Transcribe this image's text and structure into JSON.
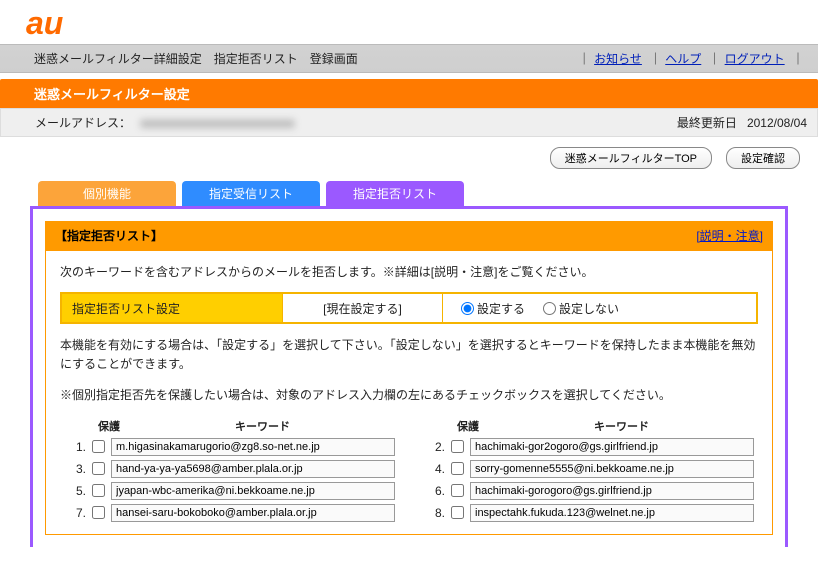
{
  "logo_alt": "au",
  "breadcrumb": "迷惑メールフィルター詳細設定　指定拒否リスト　登録画面",
  "toplinks": {
    "news": "お知らせ",
    "help": "ヘルプ",
    "logout": "ログアウト"
  },
  "orange_title": "迷惑メールフィルター設定",
  "info": {
    "mail_label": "メールアドレス：",
    "mail_value": "xxxxxxxxxxxxxxxxxxxxxx",
    "updated_label": "最終更新日",
    "updated_value": "2012/08/04"
  },
  "buttons": {
    "filter_top": "迷惑メールフィルターTOP",
    "confirm": "設定確認"
  },
  "tabs": {
    "kobetsu": "個別機能",
    "allow": "指定受信リスト",
    "block": "指定拒否リスト"
  },
  "panel": {
    "title": "【指定拒否リスト】",
    "help": "[説明・注意]",
    "desc": "次のキーワードを含むアドレスからのメールを拒否します。※詳細は[説明・注意]をご覧ください。",
    "setting_label": "指定拒否リスト設定",
    "current": "[現在設定する]",
    "opt_on": "設定する",
    "opt_off": "設定しない",
    "note1": "本機能を有効にする場合は、「設定する」を選択して下さい。「設定しない」を選択するとキーワードを保持したまま本機能を無効にすることができます。",
    "note2": "※個別指定拒否先を保護したい場合は、対象のアドレス入力欄の左にあるチェックボックスを選択してください。",
    "col_protect": "保護",
    "col_keyword": "キーワード"
  },
  "keywords_left": [
    {
      "n": "1.",
      "v": "m.higasinakamarugorio@zg8.so-net.ne.jp"
    },
    {
      "n": "3.",
      "v": "hand-ya-ya-ya5698@amber.plala.or.jp"
    },
    {
      "n": "5.",
      "v": "jyapan-wbc-amerika@ni.bekkoame.ne.jp"
    },
    {
      "n": "7.",
      "v": "hansei-saru-bokoboko@amber.plala.or.jp"
    }
  ],
  "keywords_right": [
    {
      "n": "2.",
      "v": "hachimaki-gor2ogoro@gs.girlfriend.jp"
    },
    {
      "n": "4.",
      "v": "sorry-gomenne5555@ni.bekkoame.ne.jp"
    },
    {
      "n": "6.",
      "v": "hachimaki-gorogoro@gs.girlfriend.jp"
    },
    {
      "n": "8.",
      "v": "inspectahk.fukuda.123@welnet.ne.jp"
    }
  ]
}
